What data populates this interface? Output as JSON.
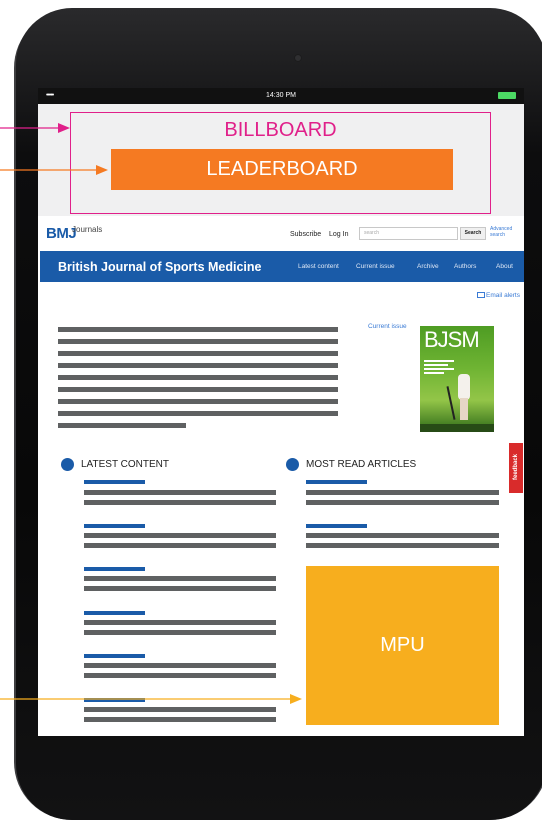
{
  "status_bar": {
    "time": "14:30 PM",
    "signal": "•••••",
    "battery_color": "#4cd964"
  },
  "ads": {
    "billboard": "BILLBOARD",
    "leaderboard": "LEADERBOARD",
    "mpu": "MPU",
    "billboard_color": "#e0208a",
    "leaderboard_color": "#f57a22",
    "mpu_color": "#f7ae1e"
  },
  "header": {
    "logo": "BMJ",
    "logo_sub": "Journals",
    "subscribe": "Subscribe",
    "login": "Log In",
    "search_placeholder": "search",
    "search_button": "Search",
    "advanced_search": "Advanced search"
  },
  "nav": {
    "journal_title": "British Journal of Sports Medicine",
    "links": [
      "Latest content",
      "Current issue",
      "Archive",
      "Authors",
      "About"
    ],
    "color": "#1a5ba8"
  },
  "email_alerts": "Email alerts",
  "current_issue": "Current issue",
  "cover": {
    "title": "BJSM"
  },
  "sections": {
    "latest": "LATEST CONTENT",
    "most_read": "MOST READ ARTICLES"
  },
  "feedback": "feedback"
}
